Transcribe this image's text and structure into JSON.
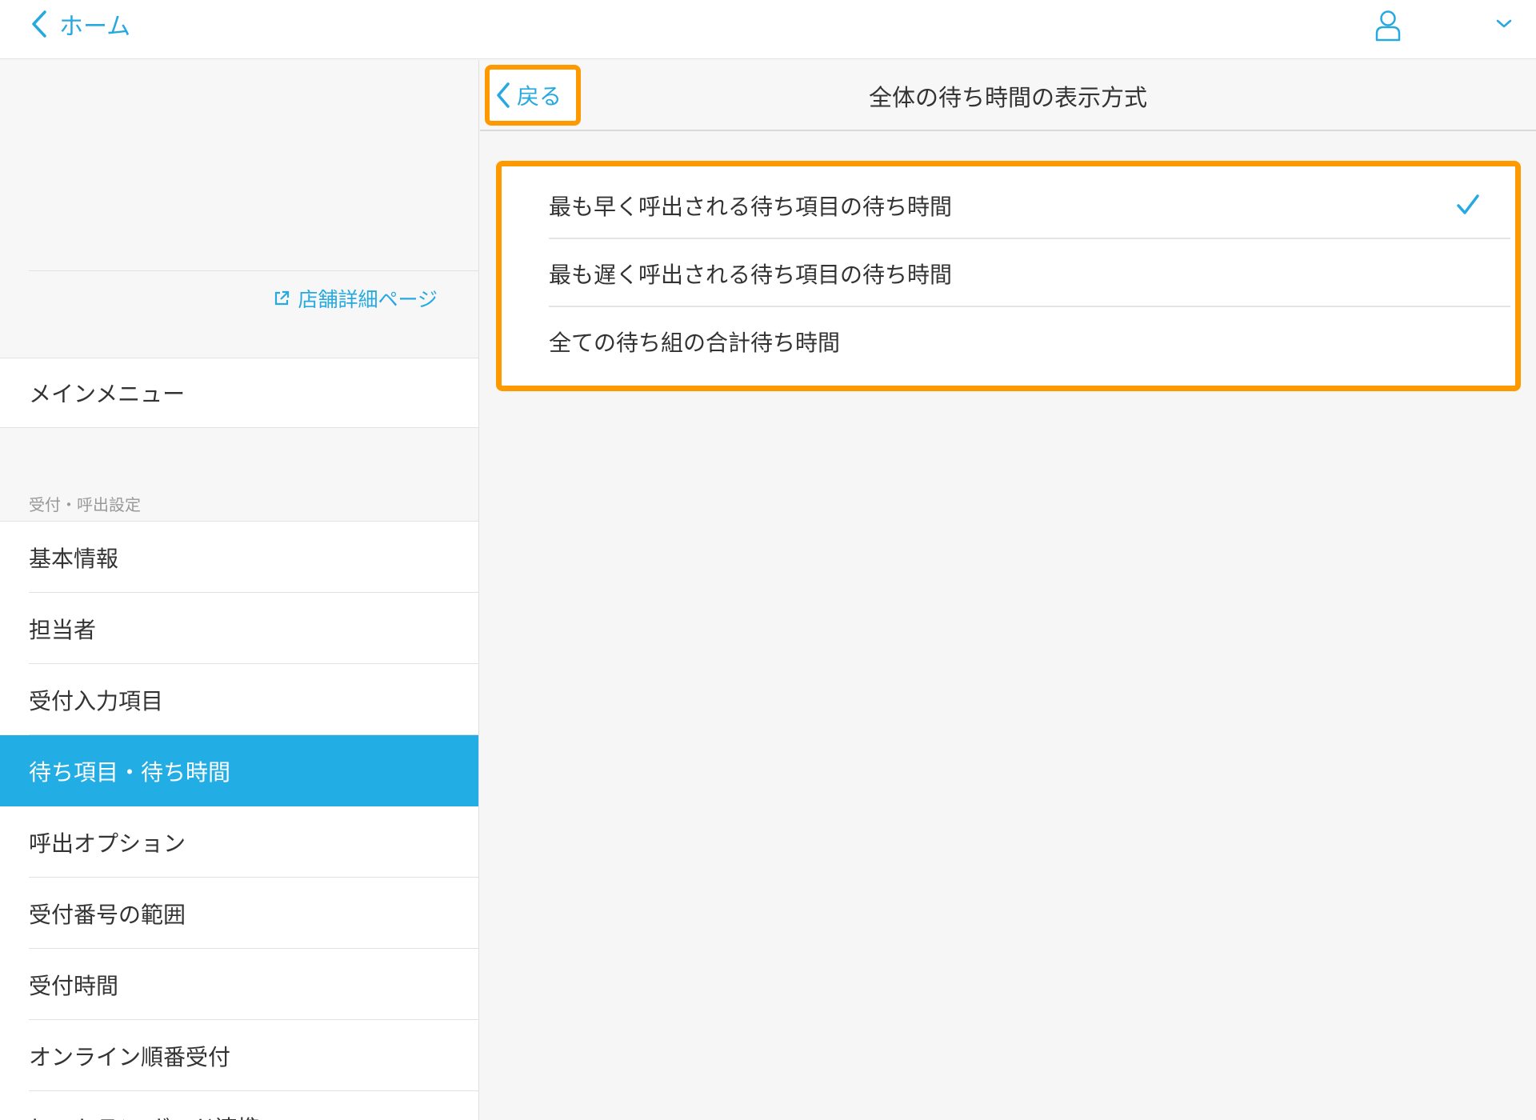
{
  "topbar": {
    "home_label": "ホーム",
    "icons": {
      "back": "chevron-left-icon",
      "user": "user-icon",
      "dropdown": "chevron-down-icon"
    }
  },
  "sidebar": {
    "store_link_label": "店舗詳細ページ",
    "main_menu_label": "メインメニュー",
    "section_header": "受付・呼出設定",
    "items": [
      {
        "label": "基本情報",
        "active": false
      },
      {
        "label": "担当者",
        "active": false
      },
      {
        "label": "受付入力項目",
        "active": false
      },
      {
        "label": "待ち項目・待ち時間",
        "active": true
      },
      {
        "label": "呼出オプション",
        "active": false
      },
      {
        "label": "受付番号の範囲",
        "active": false
      },
      {
        "label": "受付時間",
        "active": false
      },
      {
        "label": "オンライン順番受付",
        "active": false
      },
      {
        "label": "ヒストラン ボード連携",
        "active": false
      }
    ]
  },
  "content": {
    "back_label": "戻る",
    "title": "全体の待ち時間の表示方式",
    "options": [
      {
        "label": "最も早く呼出される待ち項目の待ち時間",
        "selected": true
      },
      {
        "label": "最も遅く呼出される待ち項目の待ち時間",
        "selected": false
      },
      {
        "label": "全ての待ち組の合計待ち時間",
        "selected": false
      }
    ]
  },
  "colors": {
    "accent": "#26a9e0",
    "active_item_bg": "#22ade4",
    "highlight": "#ff9900",
    "text": "#333333"
  }
}
